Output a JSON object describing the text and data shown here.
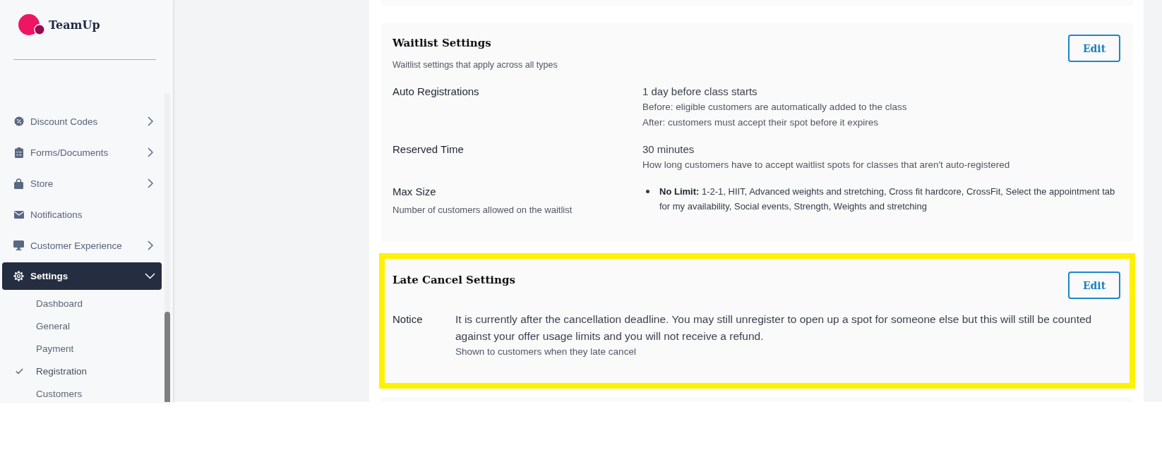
{
  "sidebar": {
    "logo": {
      "name": "TeamUp"
    },
    "menu": [
      {
        "label": "Discount Codes",
        "kind": "group",
        "selected": false,
        "expanded": false
      },
      {
        "label": "Forms/Documents",
        "kind": "group",
        "selected": false,
        "expanded": false
      },
      {
        "label": "Store",
        "kind": "group",
        "selected": false,
        "expanded": false
      },
      {
        "label": "Notifications",
        "kind": "link",
        "selected": false
      },
      {
        "label": "Customer Experience",
        "kind": "group",
        "selected": false,
        "expanded": false
      },
      {
        "label": "Settings",
        "kind": "group",
        "selected": true,
        "expanded": true,
        "children": [
          {
            "label": "Dashboard",
            "selected": false
          },
          {
            "label": "General",
            "selected": false
          },
          {
            "label": "Payment",
            "selected": false
          },
          {
            "label": "Registration",
            "selected": true
          },
          {
            "label": "Customers",
            "selected": false
          }
        ]
      }
    ]
  },
  "waitlist_settings": {
    "title": "Waitlist Settings",
    "subtitle": "Waitlist settings that apply across all types",
    "edit_button": "Edit",
    "highlighted": false,
    "rows": [
      {
        "label": "Auto Registrations",
        "value": "1 day before class starts",
        "details": [
          "Before: eligible customers are automatically added to the class",
          "After: customers must accept their spot before it expires"
        ]
      },
      {
        "label": "Reserved Time",
        "value": "30 minutes",
        "details": [
          "How long customers have to accept waitlist spots for classes that aren't auto-registered"
        ]
      },
      {
        "label": "Max Size",
        "description": "Number of customers allowed on the waitlist",
        "items": [
          "**No Limit:** 1-2-1, HIIT, Advanced weights and stretching, Cross fit hardcore, CrossFit, Select the appointment tab for my availability, Social events, Strength, Weights and stretching"
        ]
      }
    ]
  },
  "late_cancel_settings": {
    "title": "Late Cancel Settings",
    "edit_button": "Edit",
    "highlighted": true,
    "rows": [
      {
        "label": "Notice",
        "value": "It is currently after the cancellation deadline. You may still unregister to open up a spot for someone else but this will still be counted against your offer usage limits and you will not receive a refund.",
        "details": [
          "Shown to customers when they late cancel"
        ]
      }
    ]
  }
}
